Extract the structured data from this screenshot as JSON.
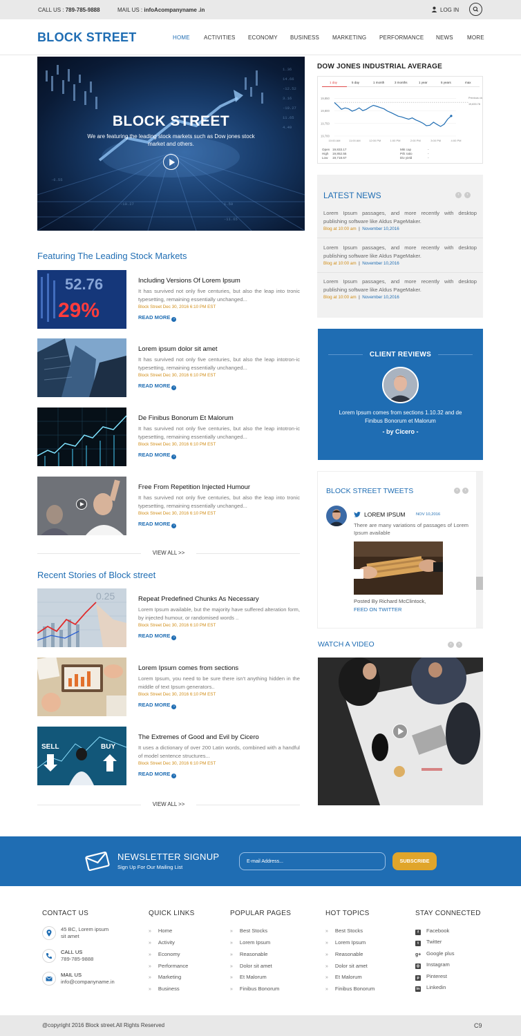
{
  "topbar": {
    "call_label": "CALL US :",
    "call_number": "789-785-9888",
    "mail_label": "MAIL US :",
    "mail_value": "infoAcompanyname .in",
    "login": "LOG IN"
  },
  "header": {
    "logo": "BLOCK STREET",
    "nav": [
      "HOME",
      "ACTIVITIES",
      "ECONOMY",
      "BUSINESS",
      "MARKETING",
      "PERFORMANCE",
      "NEWS",
      "MORE"
    ]
  },
  "hero": {
    "title": "BLOCK STREET",
    "text": "We are featuring the leading stock markets such as Dow jones stock market and others."
  },
  "featured": {
    "title": "Featuring The Leading Stock Markets",
    "articles": [
      {
        "title": "Including Versions Of Lorem Ipsum",
        "text": "It has survived not only five centuries, but also the leap into tronic typesetting, remaining essentially unchanged...",
        "meta": "Block Street Dec 30, 2016 6:10 PM EST",
        "more": "READ MORE"
      },
      {
        "title": "Lorem ipsum dolor sit amet",
        "text": "It has survived not only five centuries, but also the leap intotron-ic typesetting, remaining essentially unchanged...",
        "meta": "Block Street Dec 30, 2016 6:10 PM EST",
        "more": "READ MORE"
      },
      {
        "title": "De Finibus Bonorum Et Malorum",
        "text": "It has survived not only five centuries, but also the leap intotron-ic typesetting, remaining essentially unchanged...",
        "meta": "Block Street Dec 30, 2016 6:10 PM EST",
        "more": "READ MORE"
      },
      {
        "title": "Free From Repetition Injected Humour",
        "text": "It has survived not only five centuries, but also the leap into tronic typesetting, remaining essentially unchanged...",
        "meta": "Block Street Dec 30, 2016 6:10 PM EST",
        "more": "READ MORE"
      }
    ],
    "view_all": "VIEW ALL >>"
  },
  "recent": {
    "title": "Recent Stories of Block street",
    "articles": [
      {
        "title": "Repeat Predefined Chunks As Necessary",
        "text": "Lorem Ipsum available, but the majority have suffered alteration form, by injected humour, or randomised words ..",
        "meta": "Block Street Dec 30, 2016 6:10 PM EST",
        "more": "READ MORE"
      },
      {
        "title": "Lorem Ipsum comes from sections",
        "text": "Lorem Ipsum, you need to be sure there isn't anything hidden in the middle of text Ipsum generators..",
        "meta": "Block Street Dec 30, 2016 6:10 PM EST",
        "more": "READ MORE"
      },
      {
        "title": "The Extremes of Good and Evil by Cicero",
        "text": "It uses a dictionary of over 200 Latin words, combined with a handful of model sentence structures...",
        "meta": "Block Street Dec 30, 2016 6:10 PM EST",
        "more": "READ MORE"
      }
    ],
    "view_all": "VIEW ALL >>"
  },
  "dow": {
    "title": "DOW JONES INDUSTRIAL AVERAGE",
    "tabs": [
      "1 day",
      "5 day",
      "1 month",
      "3 months",
      "1 year",
      "5 years",
      "max"
    ],
    "stats": {
      "open_label": "Open",
      "open": "19,833.17",
      "high_label": "High",
      "high": "19,852.55",
      "low_label": "Low",
      "low": "19,718.67",
      "mktcap_label": "Mkt cap",
      "mktcap": "-",
      "pe_label": "P/E ratio",
      "pe": "-",
      "div_label": "Div yield",
      "div": "-"
    }
  },
  "chart_data": {
    "type": "line",
    "x": [
      "10:00 AM",
      "11:00 AM",
      "12:00 PM",
      "1:00 PM",
      "2:00 PM",
      "3:00 PM",
      "4:00 PM"
    ],
    "yticks": [
      19850,
      19800,
      19750,
      19700
    ],
    "previous_close_label": "Previous close",
    "previous_close_value": "19,833.78",
    "ylim": [
      19700,
      19870
    ],
    "values": [
      19833,
      19820,
      19806,
      19812,
      19808,
      19799,
      19804,
      19812,
      19801,
      19806,
      19815,
      19822,
      19818,
      19813,
      19808,
      19799,
      19793,
      19786,
      19779,
      19776,
      19771,
      19767,
      19772,
      19764,
      19758,
      19751,
      19741,
      19743,
      19755,
      19746,
      19738,
      19747,
      19767,
      19780
    ]
  },
  "latest_news": {
    "title": "LATEST NEWS",
    "items": [
      {
        "text": "Lorem Ipsum passages, and more recently with desktop publishing software like Aldus PageMaker.",
        "time": "Blog at 10:00 am",
        "date": "November 10,2016"
      },
      {
        "text": "Lorem Ipsum passages, and more recently with desktop publishing software like Aldus PageMaker.",
        "time": "Blog at 10:00 am",
        "date": "November 10,2016"
      },
      {
        "text": "Lorem Ipsum passages, and more recently with desktop publishing software like Aldus PageMaker.",
        "time": "Blog at 10:00 am",
        "date": "November 10,2016"
      }
    ]
  },
  "reviews": {
    "title": "CLIENT REVIEWS",
    "text": "Lorem Ipsum comes from sections 1.10.32 and de Finibus Bonorum et Malorum",
    "by": "- by Cicero -"
  },
  "tweets": {
    "title": "BLOCK STREET TWEETS",
    "user": "LOREM IPSUM",
    "date": "NOV 10,2016",
    "text": "There are many variations of passages of Lorem Ipsum available",
    "posted": "Posted By Richard McClintock,",
    "feed": "FEED ON TWITTER"
  },
  "video": {
    "title": "WATCH A VIDEO"
  },
  "newsletter": {
    "title": "NEWSLETTER SIGNUP",
    "subtitle": "Sign Up For Our Mailing List",
    "placeholder": "E-mail Address...",
    "button": "SUBSCRIBE"
  },
  "footer": {
    "contact": {
      "title": "CONTACT US",
      "address": [
        "45 BC, Lorem ipsum",
        "sit amet"
      ],
      "call_label": "CALL US",
      "call": "789-785-9888",
      "mail_label": "MAIL US",
      "mail": "info@companyname.in"
    },
    "quick": {
      "title": "QUICK LINKS",
      "items": [
        "Home",
        "Activity",
        "Economy",
        "Performance",
        "Marketing",
        "Business"
      ]
    },
    "popular": {
      "title": "POPULAR PAGES",
      "items": [
        "Best Stocks",
        "Lorem Ipsum",
        "Reasonable",
        "Dolor sit amet",
        "Et Malorum",
        "Finibus Bonorum"
      ]
    },
    "hot": {
      "title": "HOT TOPICS",
      "items": [
        "Best Stocks",
        "Lorem Ipsum",
        "Reasonable",
        "Dolor sit amet",
        "Et Malorum",
        "Finibus Bonorum"
      ]
    },
    "social": {
      "title": "STAY CONNECTED",
      "items": [
        "Facebook",
        "Twitter",
        "Google plus",
        "Instagram",
        "Pinterest",
        "Linkedin"
      ]
    }
  },
  "copyright": "@copyright 2016 Block street.All Rights Reserved",
  "page_code": "C9",
  "colors": {
    "brand": "#1f6db3",
    "accent": "#e0a52b",
    "meta": "#d18d16"
  }
}
